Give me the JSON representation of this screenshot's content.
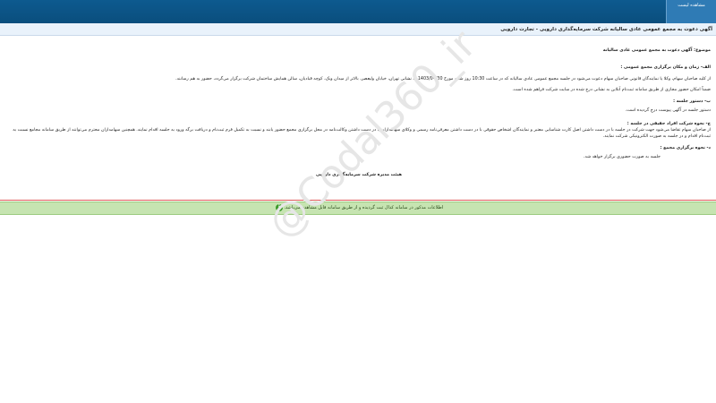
{
  "header": {
    "tab_label": "مشاهده لیست"
  },
  "title_bar": {
    "text": "آگهی دعوت به مجمع عمومی عادی سالیانه شرکت سرمایه‌گذاری دارویی - تجارت دارویی"
  },
  "notice": {
    "subject": "موضوع: آگهی دعوت به مجمع عمومی عادی سالیانه",
    "section_time_place": "الف- زمان و مکان برگزاری مجمع عمومی :",
    "time_place_text": "از کلیه صاحبان سهام، وکلا یا نمایندگان قانونی صاحبان سهام دعوت می‌شود در جلسه مجمع عمومی عادی سالیانه که در ساعت 10:30 روز شنبه مورخ 1403/04/30 به نشانی تهران، خیابان ولیعصر، بالاتر از میدان ونک، کوچه قبادیان، سالن همایش ساختمان شرکت برگزار می‌گردد، حضور به هم رسانند.",
    "online_text": "ضمناً امکان حضور مجازی از طریق سامانه ثبت‌نام آنلاین به نشانی درج شده در سایت شرکت فراهم شده است.",
    "section_agenda": "ب- دستور جلسه :",
    "agenda_text": "دستور جلسه در آگهی پیوست درج گردیده است.",
    "section_procedure": "ج- نحوه شرکت افراد حقیقی در جلسه :",
    "procedure_text": "از صاحبان سهام تقاضا می‌شود جهت شرکت در جلسه با در دست داشتن اصل کارت شناسایی معتبر و نمایندگان اشخاص حقوقی با در دست داشتن معرفی‌نامه رسمی و وکلای سهامداران با در دست داشتن وکالت‌نامه در محل برگزاری مجمع حضور یابند و نسبت به تکمیل فرم ثبت‌نام و دریافت برگه ورود به جلسه اقدام نمایند. همچنین سهامداران محترم می‌توانند از طریق سامانه مجامع نسبت به ثبت‌نام اقدام و در جلسه به صورت الکترونیکی شرکت نمایند.",
    "section_method": "د- نحوه برگزاری مجمع :",
    "method_text": "جلسه به صورت حضوری برگزار خواهد شد.",
    "signature": "هیئت مدیره شرکت سرمایه‌گذاری دارویی"
  },
  "status_bar": {
    "text": "اطلاعات مذکور در سامانه کدال ثبت گردیده و از طریق سامانه قابل مشاهده می‌باشد."
  },
  "watermark": {
    "text": "@Codal360_ir"
  }
}
